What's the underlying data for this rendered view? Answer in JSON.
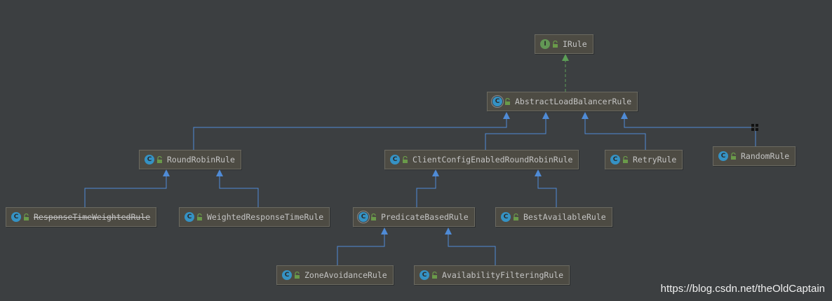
{
  "colors": {
    "background": "#3c3f41",
    "extends_edge": "#4f8bd6",
    "implements_edge": "#5c9e56",
    "class_badge": "#3592c4",
    "interface_badge": "#629755"
  },
  "nodes": {
    "irule": {
      "label": "IRule",
      "kind": "interface",
      "badge": "I",
      "icon": "interface-icon"
    },
    "abstract_load_balancer_rule": {
      "label": "AbstractLoadBalancerRule",
      "kind": "abstract-class",
      "badge": "C",
      "icon": "abstract-class-icon"
    },
    "round_robin_rule": {
      "label": "RoundRobinRule",
      "kind": "class",
      "badge": "C",
      "icon": "class-icon"
    },
    "client_config_enabled_round_robin_rule": {
      "label": "ClientConfigEnabledRoundRobinRule",
      "kind": "class",
      "badge": "C",
      "icon": "class-icon"
    },
    "retry_rule": {
      "label": "RetryRule",
      "kind": "class",
      "badge": "C",
      "icon": "class-icon"
    },
    "random_rule": {
      "label": "RandomRule",
      "kind": "class",
      "badge": "C",
      "icon": "class-icon"
    },
    "response_time_weighted_rule": {
      "label": "ResponseTimeWeightedRule",
      "kind": "class",
      "badge": "C",
      "icon": "class-icon",
      "deprecated": true
    },
    "weighted_response_time_rule": {
      "label": "WeightedResponseTimeRule",
      "kind": "class",
      "badge": "C",
      "icon": "class-icon"
    },
    "predicate_based_rule": {
      "label": "PredicateBasedRule",
      "kind": "abstract-class",
      "badge": "C",
      "icon": "abstract-class-icon"
    },
    "best_available_rule": {
      "label": "BestAvailableRule",
      "kind": "class",
      "badge": "C",
      "icon": "class-icon"
    },
    "zone_avoidance_rule": {
      "label": "ZoneAvoidanceRule",
      "kind": "class",
      "badge": "C",
      "icon": "class-icon"
    },
    "availability_filtering_rule": {
      "label": "AvailabilityFilteringRule",
      "kind": "class",
      "badge": "C",
      "icon": "class-icon"
    }
  },
  "edges": [
    {
      "from": "abstract_load_balancer_rule",
      "to": "irule",
      "type": "implements"
    },
    {
      "from": "round_robin_rule",
      "to": "abstract_load_balancer_rule",
      "type": "extends"
    },
    {
      "from": "client_config_enabled_round_robin_rule",
      "to": "abstract_load_balancer_rule",
      "type": "extends"
    },
    {
      "from": "retry_rule",
      "to": "abstract_load_balancer_rule",
      "type": "extends"
    },
    {
      "from": "random_rule",
      "to": "abstract_load_balancer_rule",
      "type": "extends"
    },
    {
      "from": "response_time_weighted_rule",
      "to": "round_robin_rule",
      "type": "extends"
    },
    {
      "from": "weighted_response_time_rule",
      "to": "round_robin_rule",
      "type": "extends"
    },
    {
      "from": "predicate_based_rule",
      "to": "client_config_enabled_round_robin_rule",
      "type": "extends"
    },
    {
      "from": "best_available_rule",
      "to": "client_config_enabled_round_robin_rule",
      "type": "extends"
    },
    {
      "from": "zone_avoidance_rule",
      "to": "predicate_based_rule",
      "type": "extends"
    },
    {
      "from": "availability_filtering_rule",
      "to": "predicate_based_rule",
      "type": "extends"
    }
  ],
  "watermark": "https://blog.csdn.net/theOldCaptain"
}
